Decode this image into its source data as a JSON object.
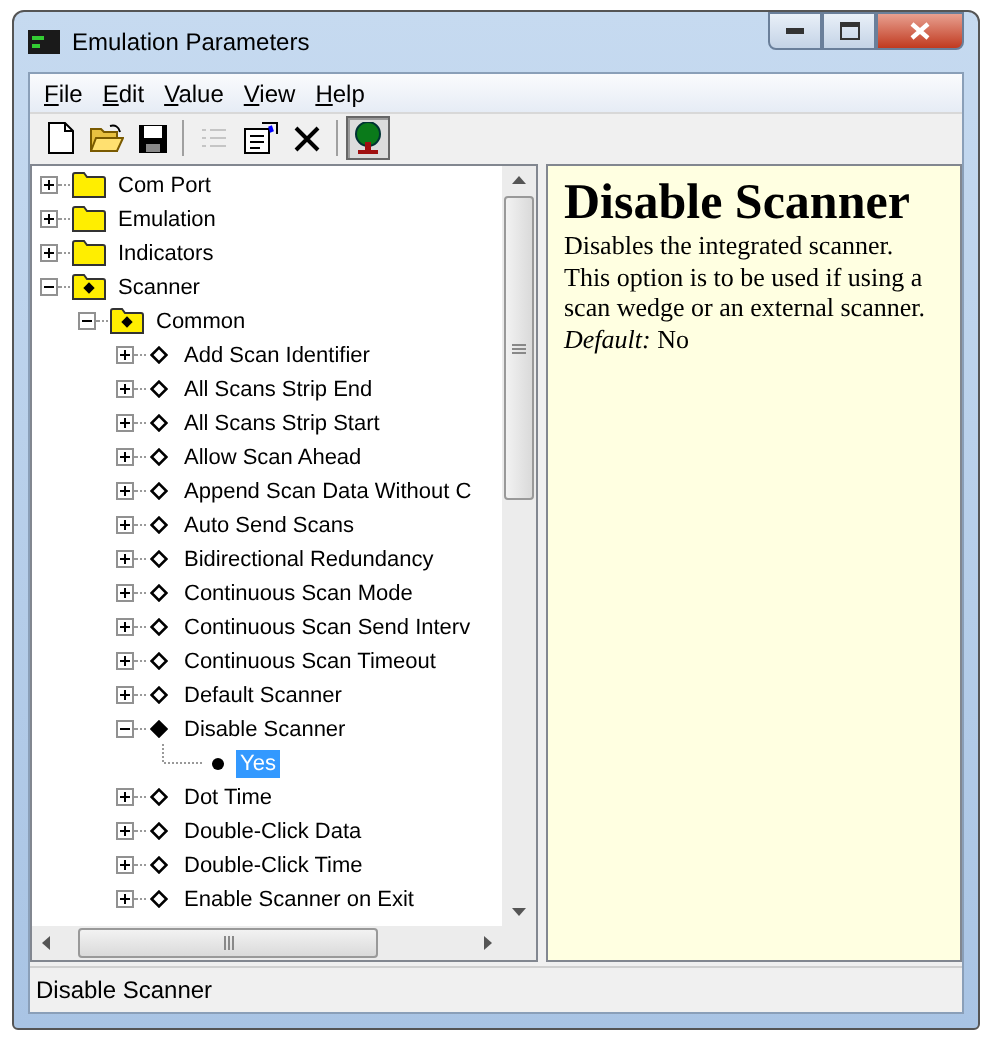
{
  "window": {
    "title": "Emulation Parameters"
  },
  "menu": [
    {
      "label": "File"
    },
    {
      "label": "Edit"
    },
    {
      "label": "Value"
    },
    {
      "label": "View"
    },
    {
      "label": "Help"
    }
  ],
  "toolbar": [
    {
      "kind": "new",
      "disabled": false,
      "pressed": false
    },
    {
      "kind": "open",
      "disabled": false,
      "pressed": false
    },
    {
      "kind": "save",
      "disabled": false,
      "pressed": false
    },
    {
      "kind": "separator"
    },
    {
      "kind": "list",
      "disabled": true,
      "pressed": false
    },
    {
      "kind": "properties",
      "disabled": false,
      "pressed": false
    },
    {
      "kind": "delete",
      "disabled": false,
      "pressed": false
    },
    {
      "kind": "separator"
    },
    {
      "kind": "tree",
      "disabled": false,
      "pressed": true
    }
  ],
  "tree": [
    {
      "label": "Com Port",
      "kind": "folder",
      "expanded": false,
      "selected": false
    },
    {
      "label": "Emulation",
      "kind": "folder",
      "expanded": false,
      "selected": false
    },
    {
      "label": "Indicators",
      "kind": "folder",
      "expanded": false,
      "selected": false
    },
    {
      "label": "Scanner",
      "kind": "marked-folder",
      "expanded": true,
      "selected": false,
      "children": [
        {
          "label": "Common",
          "kind": "marked-folder",
          "expanded": true,
          "selected": false,
          "children": [
            {
              "label": "Add Scan Identifier",
              "kind": "setting",
              "expanded": false,
              "selected": false
            },
            {
              "label": "All Scans Strip End",
              "kind": "setting",
              "expanded": false,
              "selected": false
            },
            {
              "label": "All Scans Strip Start",
              "kind": "setting",
              "expanded": false,
              "selected": false
            },
            {
              "label": "Allow Scan Ahead",
              "kind": "setting",
              "expanded": false,
              "selected": false
            },
            {
              "label": "Append Scan Data Without C",
              "kind": "setting",
              "expanded": false,
              "selected": false
            },
            {
              "label": "Auto Send Scans",
              "kind": "setting",
              "expanded": false,
              "selected": false
            },
            {
              "label": "Bidirectional Redundancy",
              "kind": "setting",
              "expanded": false,
              "selected": false
            },
            {
              "label": "Continuous Scan Mode",
              "kind": "setting",
              "expanded": false,
              "selected": false
            },
            {
              "label": "Continuous Scan Send Interv",
              "kind": "setting",
              "expanded": false,
              "selected": false
            },
            {
              "label": "Continuous Scan Timeout",
              "kind": "setting",
              "expanded": false,
              "selected": false
            },
            {
              "label": "Default Scanner",
              "kind": "setting",
              "expanded": false,
              "selected": false
            },
            {
              "label": "Disable Scanner",
              "kind": "setting",
              "expanded": true,
              "selected": false,
              "children": [
                {
                  "label": "Yes",
                  "kind": "value",
                  "selected": true
                }
              ]
            },
            {
              "label": "Dot Time",
              "kind": "setting",
              "expanded": false,
              "selected": false
            },
            {
              "label": "Double-Click Data",
              "kind": "setting",
              "expanded": false,
              "selected": false
            },
            {
              "label": "Double-Click Time",
              "kind": "setting",
              "expanded": false,
              "selected": false
            },
            {
              "label": "Enable Scanner on Exit",
              "kind": "setting",
              "expanded": false,
              "selected": false
            }
          ]
        }
      ]
    }
  ],
  "help": {
    "heading": "Disable Scanner",
    "text": "Disables the integrated scanner. This option is to be used if using a scan wedge or an external scanner.",
    "default": "*Default:* No"
  },
  "status_bar": "Disable Scanner"
}
